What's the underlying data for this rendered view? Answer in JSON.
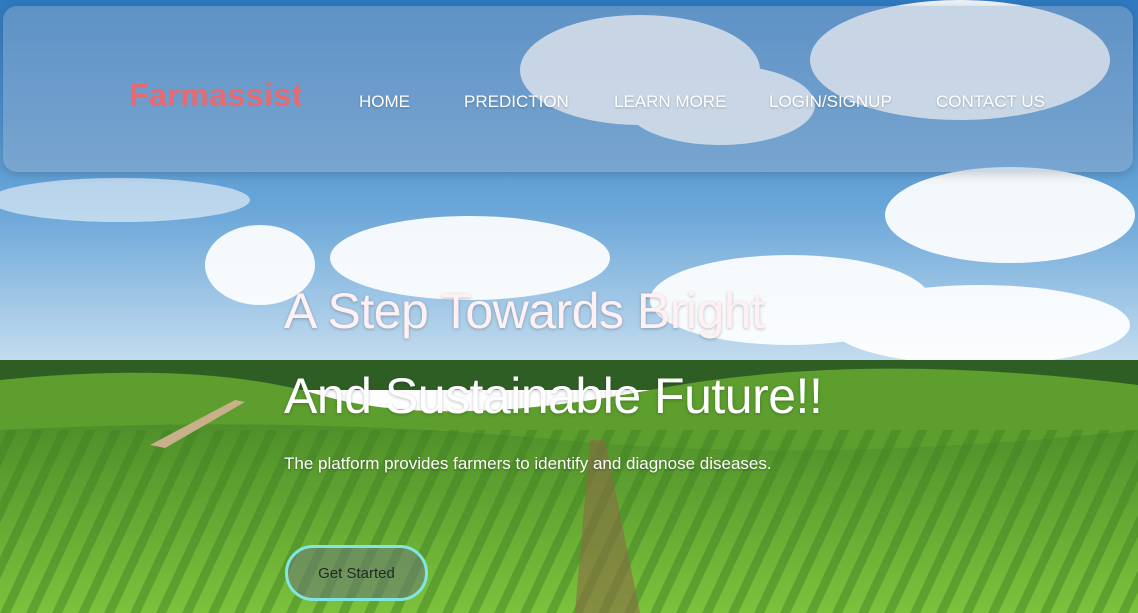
{
  "brand": "Farmassist",
  "nav": {
    "home": "HOME",
    "prediction": "PREDICTION",
    "learn_more": "LEARN MORE",
    "login_signup": "LOGIN/SIGNUP",
    "contact_us": "CONTACT US"
  },
  "hero": {
    "headline_line1": "A Step Towards Bright",
    "headline_line2": "And Sustainable Future!!",
    "subtitle": "The platform provides farmers to identify and diagnose diseases.",
    "cta_label": "Get Started"
  },
  "colors": {
    "brand": "#e86a70",
    "cta_border": "#7fe6e2",
    "sky": "#3f86c8",
    "field": "#5aa02c"
  },
  "icons": [
    "sky-background",
    "vineyard-background"
  ]
}
